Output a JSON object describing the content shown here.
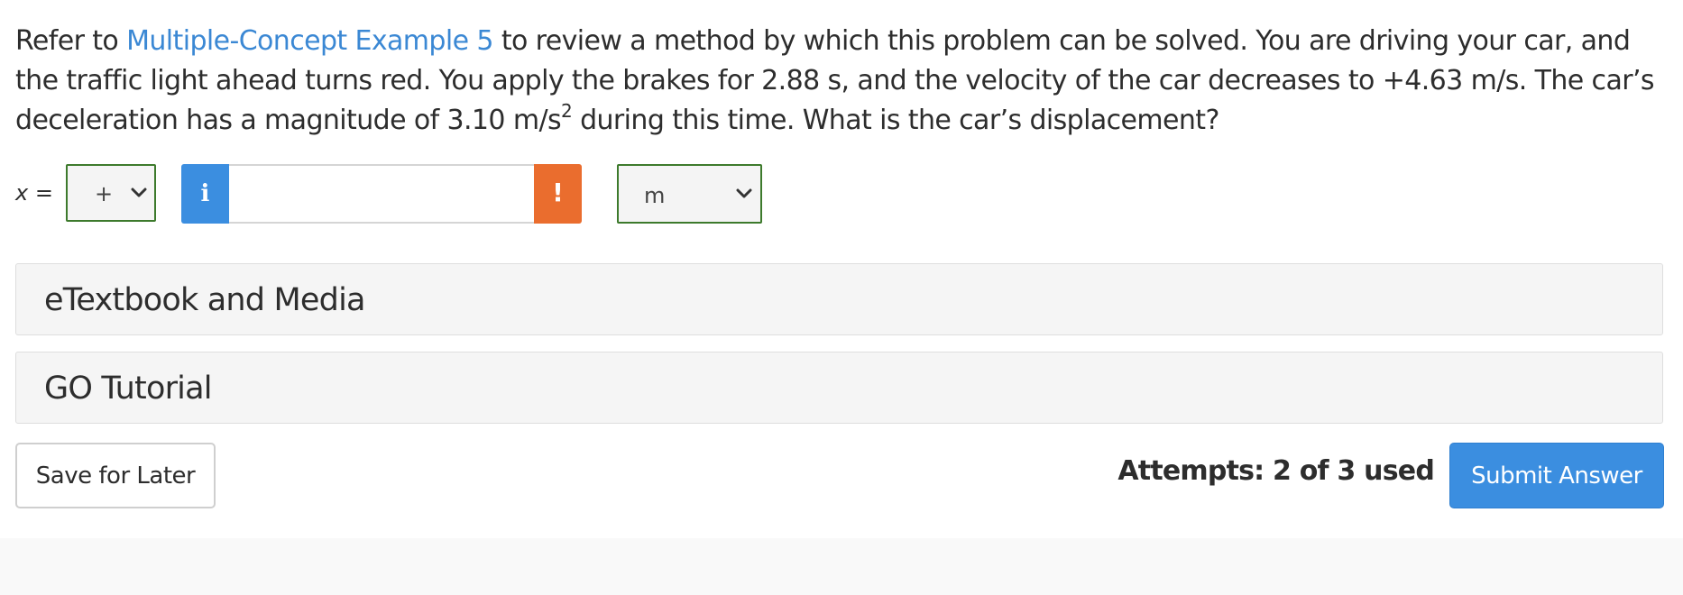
{
  "question": {
    "prefix": "Refer to ",
    "link_text": "Multiple-Concept Example 5",
    "part1": " to review a method by which this problem can be solved. You are driving your car, and the traffic light ahead turns red. You apply the brakes for 2.88 s, and the velocity of the car decreases to +4.63 m/s. The car’s deceleration has a magnitude of 3.10 m/s",
    "superscript": "2",
    "part2": " during this time. What is the car’s displacement?"
  },
  "answer": {
    "variable": "x",
    "equals": " =",
    "sign_value": "+",
    "info_glyph": "i",
    "input_value": "",
    "warning_glyph": "!",
    "unit_value": "m"
  },
  "panels": {
    "etextbook_label": "eTextbook and Media",
    "tutorial_label": "GO Tutorial"
  },
  "footer": {
    "save_label": "Save for Later",
    "attempts_text": "Attempts: 2 of 3 used",
    "submit_label": "Submit Answer"
  },
  "colors": {
    "link": "#3b88d4",
    "info_button": "#3b8ee0",
    "warning_button": "#ea6d2e",
    "select_border": "#3d7a2c",
    "submit_button": "#3b8ee0"
  },
  "icons": {
    "select_chevron": "chevron-down-icon",
    "info": "info-icon",
    "warning": "exclamation-icon"
  }
}
